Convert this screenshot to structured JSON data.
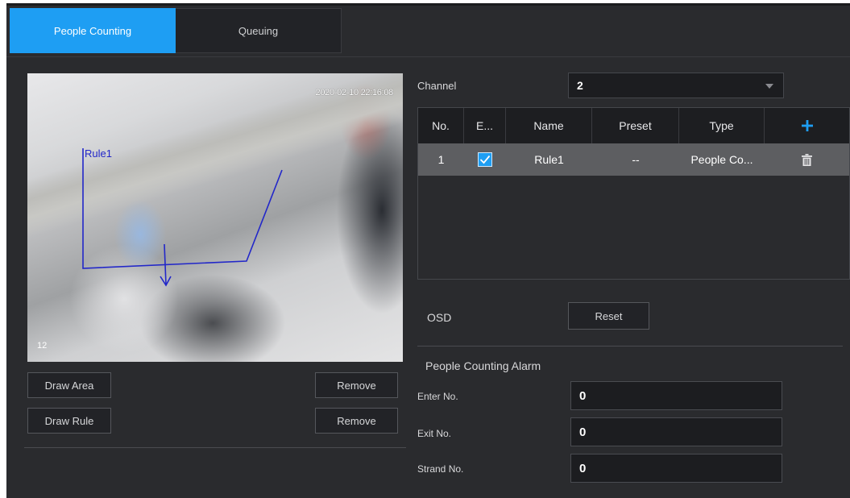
{
  "tabs": [
    {
      "label": "People Counting",
      "active": true
    },
    {
      "label": "Queuing",
      "active": false
    }
  ],
  "video": {
    "timestamp": "2020-02-10 22:16:08",
    "channel_number": "12",
    "rule_label": "Rule1",
    "rule_color": "#2227c9"
  },
  "left_buttons": {
    "draw_area": "Draw Area",
    "remove_area": "Remove",
    "draw_rule": "Draw Rule",
    "remove_rule": "Remove"
  },
  "channel": {
    "label": "Channel",
    "value": "2"
  },
  "rules_table": {
    "headers": [
      "No.",
      "E...",
      "Name",
      "Preset",
      "Type"
    ],
    "add_icon": "plus-icon",
    "rows": [
      {
        "no": "1",
        "enabled": true,
        "name": "Rule1",
        "preset": "--",
        "type": "People Co...",
        "delete_icon": "trash-icon"
      }
    ]
  },
  "osd": {
    "label": "OSD",
    "reset_label": "Reset"
  },
  "alarm": {
    "title": "People Counting Alarm",
    "enter_label": "Enter No.",
    "enter_value": "0",
    "exit_label": "Exit No.",
    "exit_value": "0",
    "strand_label": "Strand No.",
    "strand_value": "0"
  },
  "colors": {
    "accent": "#1e9ef3",
    "panel_bg": "#2a2b2e",
    "selected_row": "#5d5e61"
  }
}
